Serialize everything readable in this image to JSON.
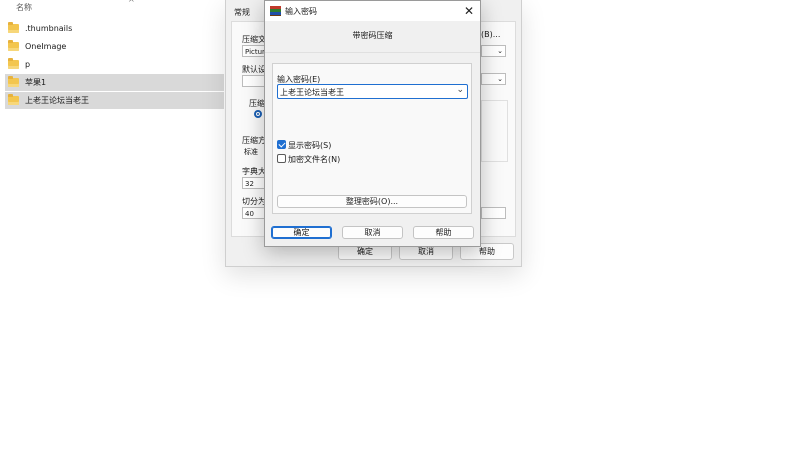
{
  "explorer": {
    "column_name": "名称",
    "up_arrow": "^",
    "items": [
      {
        "name": ".thumbnails",
        "selected": false
      },
      {
        "name": "OneImage",
        "selected": false
      },
      {
        "name": "p",
        "selected": false
      },
      {
        "name": "苹果1",
        "selected": true
      },
      {
        "name": "上老王论坛当老王",
        "selected": true
      }
    ]
  },
  "archive_dialog": {
    "tab_general": "常规",
    "label_archive": "压缩文",
    "archive_value": "Picture",
    "label_default": "默认设",
    "label_format": "压缩",
    "label_method": "压缩方",
    "method_value": "标准",
    "label_dict": "字典大",
    "dict_value": "32",
    "label_split": "切分为",
    "split_value": "40",
    "browse_partial": "(B)...",
    "buttons": {
      "ok": "确定",
      "cancel": "取消",
      "help": "帮助"
    }
  },
  "password_dialog": {
    "title": "输入密码",
    "subtitle": "带密码压缩",
    "label_enter_password": "输入密码(E)",
    "password_value": "上老王论坛当老王",
    "show_password_label": "显示密码(S)",
    "show_password_checked": true,
    "encrypt_names_label": "加密文件名(N)",
    "encrypt_names_checked": false,
    "organize_button": "整理密码(O)...",
    "buttons": {
      "ok": "确定",
      "cancel": "取消",
      "help": "帮助"
    },
    "icons": {
      "app": "winrar-books-icon",
      "close": "close-icon",
      "chevron": "chevron-down-icon"
    }
  }
}
